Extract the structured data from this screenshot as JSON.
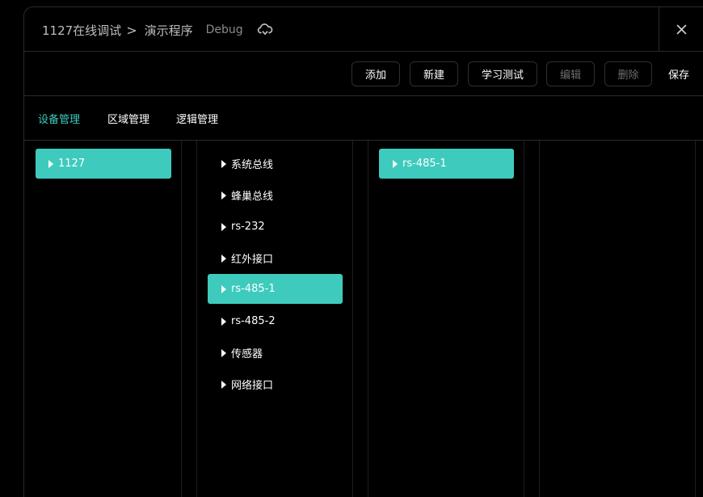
{
  "header": {
    "breadcrumb_root": "1127在线调试",
    "breadcrumb_separator": ">",
    "breadcrumb_current": "演示程序",
    "mode_label": "Debug",
    "close_symbol": "×"
  },
  "toolbar": {
    "buttons": [
      {
        "label": "添加",
        "disabled": false
      },
      {
        "label": "新建",
        "disabled": false
      },
      {
        "label": "学习测试",
        "disabled": false
      },
      {
        "label": "编辑",
        "disabled": true
      },
      {
        "label": "删除",
        "disabled": true
      }
    ],
    "save_label": "保存"
  },
  "tabs": [
    {
      "label": "设备管理",
      "active": true
    },
    {
      "label": "区域管理",
      "active": false
    },
    {
      "label": "逻辑管理",
      "active": false
    }
  ],
  "columns": {
    "devices": [
      {
        "label": "1127",
        "selected": true
      }
    ],
    "interfaces": [
      {
        "label": "系统总线",
        "selected": false
      },
      {
        "label": "蜂巢总线",
        "selected": false
      },
      {
        "label": "rs-232",
        "selected": false
      },
      {
        "label": "红外接口",
        "selected": false
      },
      {
        "label": "rs-485-1",
        "selected": true
      },
      {
        "label": "rs-485-2",
        "selected": false
      },
      {
        "label": "传感器",
        "selected": false
      },
      {
        "label": "网络接口",
        "selected": false
      }
    ],
    "sub_items": [
      {
        "label": "rs-485-1",
        "selected": true
      }
    ]
  },
  "colors": {
    "accent": "#3ecbbd",
    "background": "#000000",
    "border": "#2a2a2a"
  }
}
